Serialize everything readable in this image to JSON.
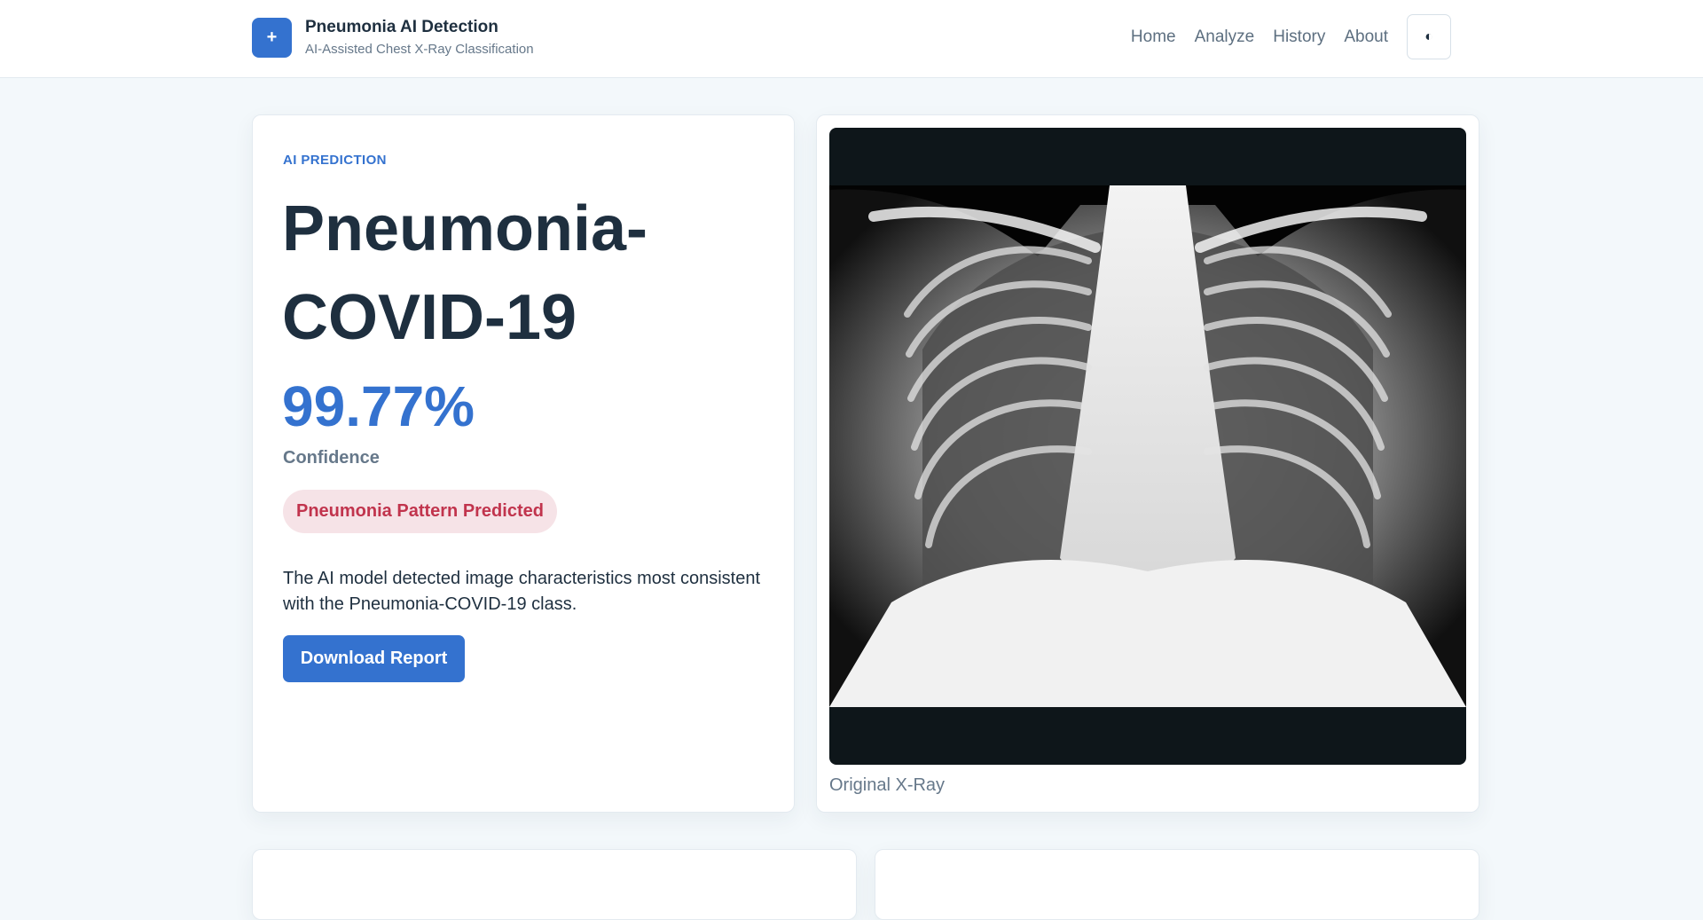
{
  "header": {
    "logo_glyph": "+",
    "title": "Pneumonia AI Detection",
    "subtitle": "AI-Assisted Chest X-Ray Classification",
    "nav": [
      {
        "label": "Home"
      },
      {
        "label": "Analyze"
      },
      {
        "label": "History"
      },
      {
        "label": "About"
      }
    ],
    "theme_toggle_glyph": "◐"
  },
  "prediction": {
    "eyebrow": "AI PREDICTION",
    "class_name": "Pneumonia-COVID-19",
    "confidence_value": "99.77%",
    "confidence_label": "Confidence",
    "status_badge": "Pneumonia Pattern Predicted",
    "explanation": "The AI model detected image characteristics most consistent with the Pneumonia-COVID-19 class.",
    "download_label": "Download Report"
  },
  "xray": {
    "caption": "Original X-Ray"
  },
  "colors": {
    "accent": "#3472cf",
    "background": "#f3f8fb",
    "badge_background": "#f6e3e7",
    "badge_text": "#c1344d",
    "heading_text": "#1e2f3f",
    "muted_text": "#66788a"
  },
  "icons": {
    "logo": "plus-icon",
    "theme_toggle": "contrast-icon"
  }
}
